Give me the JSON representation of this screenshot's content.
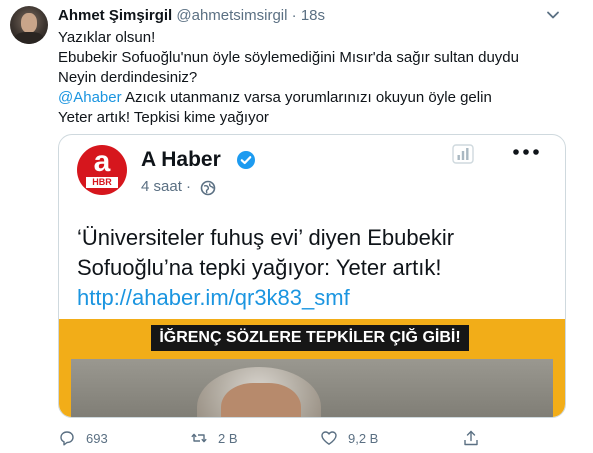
{
  "tweet": {
    "display_name": "Ahmet Şimşirgil",
    "handle": "@ahmetsimsirgil",
    "separator": "·",
    "time": "18s",
    "lines": [
      "Yazıklar olsun!",
      "Ebubekir Sofuoğlu'nun öyle söylemediğini Mısır'da sağır sultan duydu",
      "Neyin derdindesiniz?"
    ],
    "mention": "@Ahaber",
    "mention_rest": " Azıcık utanmanız varsa yorumlarınızı okuyun öyle gelin",
    "last_line": "Yeter artık! Tepkisi kime yağıyor"
  },
  "embed": {
    "logo_letter": "a",
    "logo_sub": "HBR",
    "name": "A Haber",
    "time": "4 saat",
    "separator": "·",
    "text_lines": [
      "‘Üniversiteler fuhuş evi’ diyen Ebubekir",
      "Sofuoğlu’na tepki yağıyor: Yeter artık!"
    ],
    "link": "http://ahaber.im/qr3k83_smf",
    "banner": "İĞRENÇ SÖZLERE TEPKİLER ÇIĞ GİBİ!"
  },
  "actions": {
    "reply_count": "693",
    "retweet_count": "2 B",
    "like_count": "9,2 B"
  },
  "colors": {
    "accent": "#1b95e0",
    "muted": "#5b7083",
    "brand_red": "#d6161d",
    "banner_yellow": "#f2ad18"
  },
  "icons": [
    "caret-down-icon",
    "verified-badge-icon",
    "globe-icon",
    "analytics-icon",
    "more-icon",
    "reply-icon",
    "retweet-icon",
    "like-icon",
    "share-icon"
  ]
}
